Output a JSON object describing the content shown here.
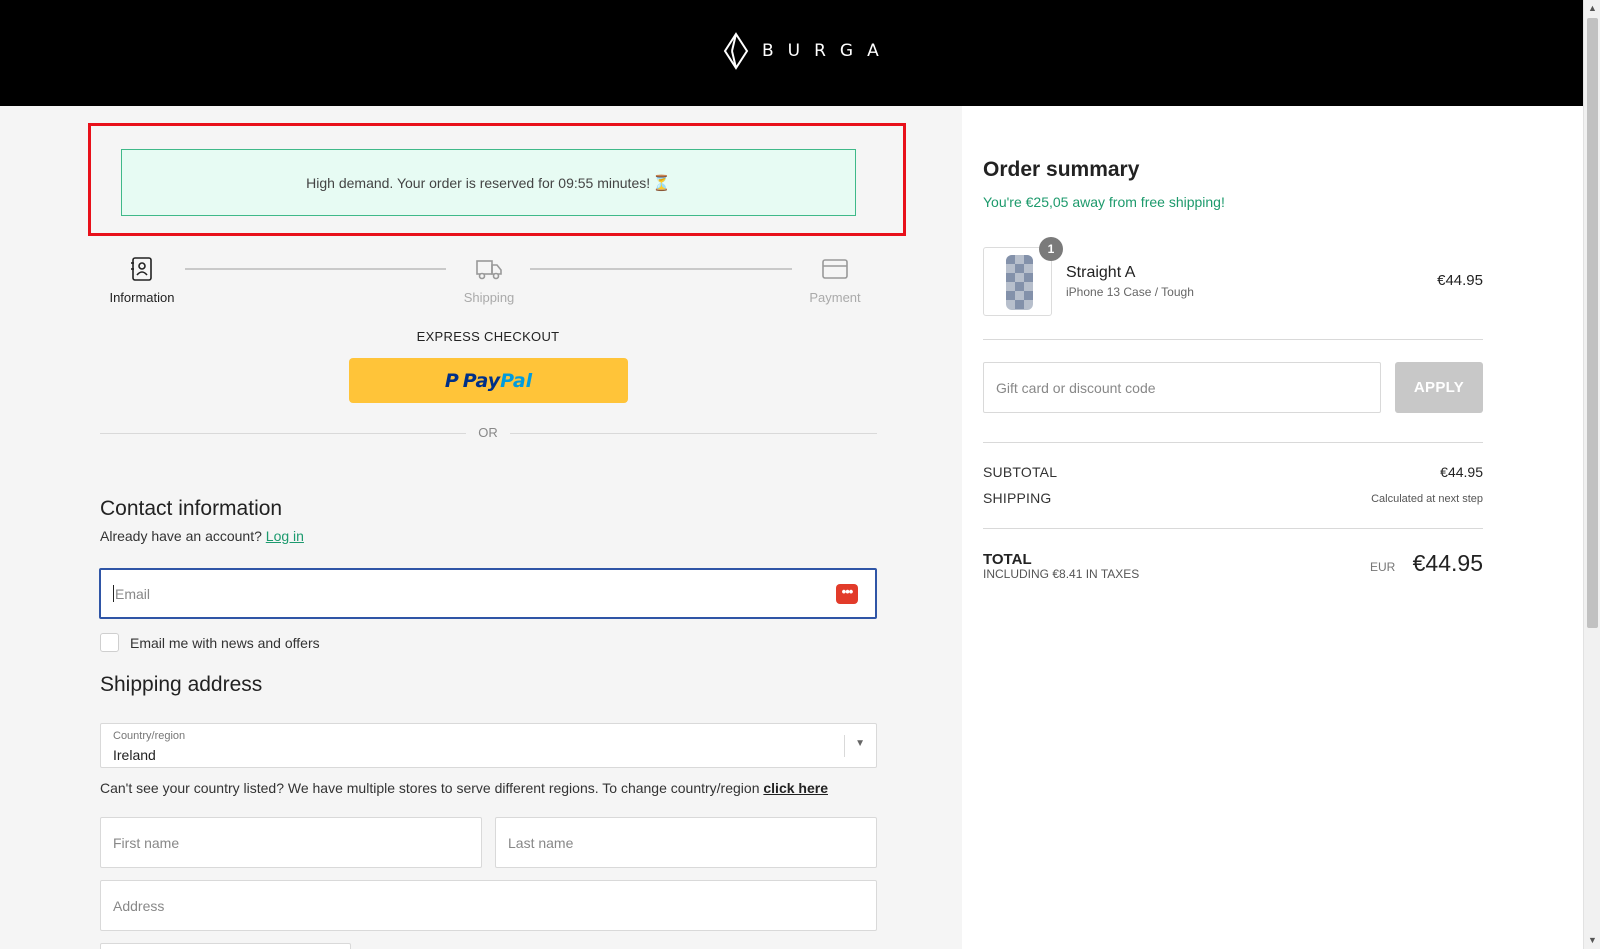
{
  "brand": {
    "name": "BURGA"
  },
  "banner": {
    "text": "High demand. Your order is reserved for 09:55 minutes!",
    "icon": "hourglass-icon",
    "highlight_color": "#e8101a",
    "bg_color": "#e7fbf3"
  },
  "steps": [
    {
      "label": "Information",
      "icon": "contact-card-icon",
      "active": true
    },
    {
      "label": "Shipping",
      "icon": "truck-icon",
      "active": false
    },
    {
      "label": "Payment",
      "icon": "credit-card-icon",
      "active": false
    }
  ],
  "express": {
    "title": "EXPRESS CHECKOUT",
    "paypal_pay": "Pay",
    "paypal_pal": "Pal",
    "paypal_color": "#ffc439",
    "or_text": "OR"
  },
  "contact": {
    "title": "Contact information",
    "account_prompt": "Already have an account?",
    "login_link": "Log in",
    "email_placeholder": "Email",
    "email_value": "",
    "newsletter_label": "Email me with news and offers"
  },
  "shipping_address": {
    "title": "Shipping address",
    "country_label": "Country/region",
    "country_value": "Ireland",
    "country_note": "Can't see your country listed? We have multiple stores to serve different regions. To change country/region",
    "click_here": "click here",
    "first_name_placeholder": "First name",
    "last_name_placeholder": "Last name",
    "address_placeholder": "Address"
  },
  "summary": {
    "title": "Order summary",
    "free_shipping": "You're €25,05 away from free shipping!",
    "item": {
      "quantity": "1",
      "name": "Straight A",
      "variant": "iPhone 13 Case / Tough",
      "price": "€44.95"
    },
    "discount_placeholder": "Gift card or discount code",
    "apply_label": "APPLY",
    "subtotal_label": "SUBTOTAL",
    "subtotal_value": "€44.95",
    "shipping_label": "SHIPPING",
    "shipping_value": "Calculated at next step",
    "total_label": "TOTAL",
    "total_sub": "INCLUDING €8.41 IN TAXES",
    "currency": "EUR",
    "total_value": "€44.95",
    "accent_color": "#1d9a6c"
  }
}
